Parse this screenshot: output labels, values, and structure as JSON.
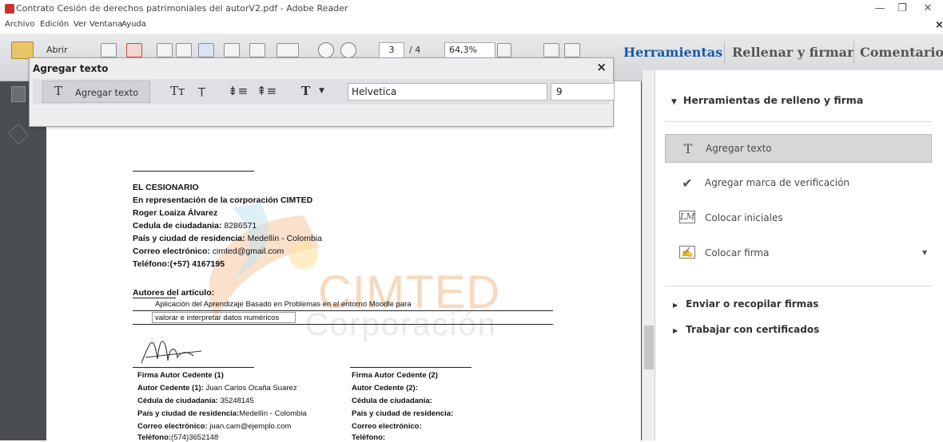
{
  "window": {
    "title": "Contrato Cesión de derechos patrimoniales del autorV2.pdf - Adobe Reader",
    "controls": {
      "minimize": "—",
      "restore": "❐",
      "close": "✕"
    }
  },
  "menu": [
    "Archivo",
    "Edición",
    "Ver",
    "Ventana",
    "Ayuda"
  ],
  "toolbar": {
    "open_label": "Abrir",
    "page_number": "3",
    "page_total": "/ 4",
    "zoom": "64,3%"
  },
  "right_tabs": [
    "Herramientas",
    "Rellenar y firmar",
    "Comentario"
  ],
  "add_text_panel": {
    "title": "Agregar texto",
    "close": "×",
    "tool_label": "Agregar texto",
    "font": "Helvetica",
    "size": "9"
  },
  "document": {
    "cesionario": {
      "heading": "EL CESIONARIO",
      "line1": "En representación de la corporación CIMTED",
      "name": "Roger Loaiza Álvarez",
      "cedula_label": "Cedula de ciudadania:",
      "cedula_value": "8286571",
      "residence_label": "País y ciudad de residencia:",
      "residence_value": "Medellín - Colombia",
      "email_label": "Correo electrónico:",
      "email_value": "cimted@gmail.com",
      "phone_label": "Teléfono:",
      "phone_value": "(+57) 4167195"
    },
    "authors_label": "Autores del artículo:",
    "article_line1": "Aplicación del Aprendizaje Basado en Problemas en el entorno Moodle para",
    "article_line2": "valorar e interpretar datos numéricos",
    "watermark_main": "CIMTED",
    "watermark_sub": "Corporación",
    "author1": {
      "heading": "Firma Autor Cedente (1)",
      "author_label": "Autor Cedente (1):",
      "author_value": "Juan Carlos Ocaña Suarez",
      "cedula_label": "Cédula de ciudadanía:",
      "cedula_value": "35248145",
      "residence_label": "País y ciudad de residencia:",
      "residence_value": "Medellín - Colombia",
      "email_label": "Correo electrónico:",
      "email_value": "juan.cam@ejemplo.com",
      "phone_label": "Teléfono:",
      "phone_value": "(574)3652148"
    },
    "author2": {
      "heading": "Firma Autor Cedente (2)",
      "author_label": "Autor Cedente (2):",
      "cedula_label": "Cédula de ciudadanía:",
      "residence_label": "País y ciudad de residencia:",
      "email_label": "Correo electrónico:",
      "phone_label": "Teléfono:"
    }
  },
  "right_pane": {
    "section_open": "Herramientas de relleno y firma",
    "items": [
      {
        "label": "Agregar texto",
        "icon": "text-icon"
      },
      {
        "label": "Agregar marca de verificación",
        "icon": "checkmark-icon"
      },
      {
        "label": "Colocar iniciales",
        "icon": "initials-icon"
      },
      {
        "label": "Colocar firma",
        "icon": "signature-icon"
      }
    ],
    "section_closed_1": "Enviar o recopilar firmas",
    "section_closed_2": "Trabajar con certificados"
  }
}
